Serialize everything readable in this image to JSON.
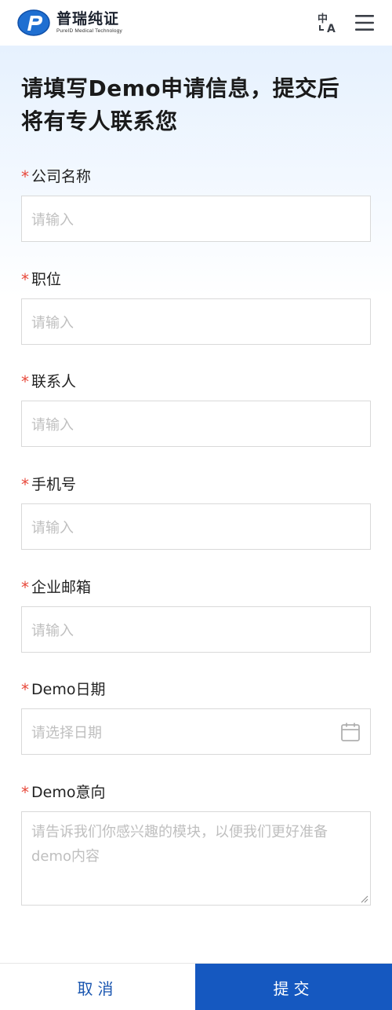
{
  "header": {
    "logo_cn": "普瑞纯证",
    "logo_en": "PureID Medical Technology",
    "logo_icon": "pureid-logo-icon",
    "language_icon": "translate-icon",
    "menu_icon": "hamburger-menu-icon"
  },
  "page": {
    "title_line1": "请填写Demo申请信息，提交后",
    "title_line2": "将有专人联系您"
  },
  "form": {
    "required_mark": "*",
    "fields": [
      {
        "label": "公司名称",
        "placeholder": "请输入",
        "value": ""
      },
      {
        "label": "职位",
        "placeholder": "请输入",
        "value": ""
      },
      {
        "label": "联系人",
        "placeholder": "请输入",
        "value": ""
      },
      {
        "label": "手机号",
        "placeholder": "请输入",
        "value": ""
      },
      {
        "label": "企业邮箱",
        "placeholder": "请输入",
        "value": ""
      },
      {
        "label": "Demo日期",
        "placeholder": "请选择日期",
        "value": ""
      },
      {
        "label": "Demo意向",
        "placeholder": "请告诉我们你感兴趣的模块，以便我们更好准备demo内容",
        "value": ""
      }
    ]
  },
  "actions": {
    "cancel_label": "取消",
    "submit_label": "提交"
  },
  "colors": {
    "primary": "#1558c0",
    "required": "#e8483a",
    "placeholder": "#bfbfbf"
  }
}
